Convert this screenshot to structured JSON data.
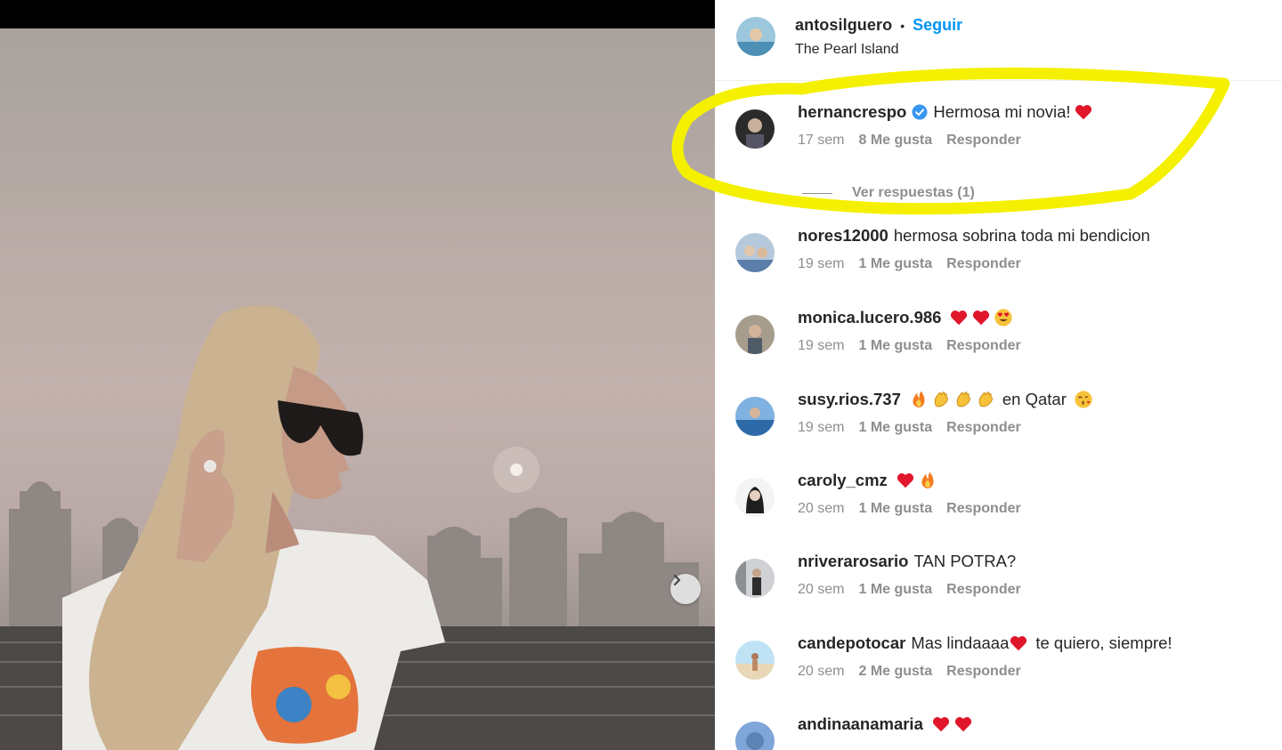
{
  "post": {
    "username": "antosilguero",
    "separator": "•",
    "follow_label": "Seguir",
    "location": "The Pearl Island"
  },
  "view_replies_label": "Ver respuestas (1)",
  "comments": [
    {
      "username": "hernancrespo",
      "verified": true,
      "text": "Hermosa mi novia!",
      "emoji": [
        "red-heart"
      ],
      "time": "17 sem",
      "likes": "8 Me gusta",
      "reply": "Responder"
    },
    {
      "username": "nores12000",
      "text": "hermosa sobrina toda mi bendicion",
      "emoji": [],
      "time": "19 sem",
      "likes": "1 Me gusta",
      "reply": "Responder"
    },
    {
      "username": "monica.lucero.986",
      "text": "",
      "emoji": [
        "red-heart",
        "red-heart",
        "heart-eyes"
      ],
      "time": "19 sem",
      "likes": "1 Me gusta",
      "reply": "Responder"
    },
    {
      "username": "susy.rios.737",
      "text": "en Qatar",
      "emoji": [
        "fire",
        "clap",
        "clap",
        "clap"
      ],
      "emoji_after": [
        "kiss-face"
      ],
      "time": "19 sem",
      "likes": "1 Me gusta",
      "reply": "Responder"
    },
    {
      "username": "caroly_cmz",
      "text": "",
      "emoji": [
        "red-heart",
        "fire"
      ],
      "time": "20 sem",
      "likes": "1 Me gusta",
      "reply": "Responder"
    },
    {
      "username": "nriverarosario",
      "text": "TAN POTRA?",
      "emoji": [],
      "time": "20 sem",
      "likes": "1 Me gusta",
      "reply": "Responder"
    },
    {
      "username": "candepotocar",
      "text": "Mas lindaaaa",
      "text2": "te quiero, siempre!",
      "emoji": [
        "red-heart"
      ],
      "time": "20 sem",
      "likes": "2 Me gusta",
      "reply": "Responder"
    },
    {
      "username": "andinaanamaria",
      "text": "",
      "emoji": [
        "red-heart",
        "red-heart"
      ]
    }
  ],
  "colors": {
    "accent": "#0095f6",
    "highlight": "#f5f000",
    "heart": "#e0162b",
    "meta": "#8e8e8e"
  }
}
